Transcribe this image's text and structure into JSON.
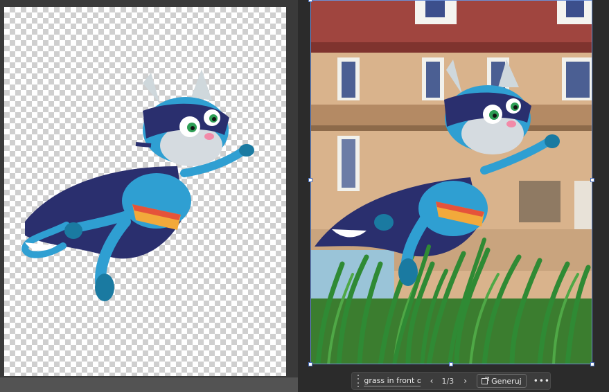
{
  "toolbar": {
    "prompt": "grass in front o...",
    "prev_icon": "chevron-left",
    "next_icon": "chevron-right",
    "counter": "1/3",
    "generate_label": "Generuj",
    "generate_icon": "external-generate",
    "more_icon": "ellipsis"
  },
  "colors": {
    "workspace_bg": "#2b2b2b",
    "left_panel_bg": "#3a3a3a",
    "selection_blue": "#6b8fd6",
    "cat_blue": "#2f9fd2",
    "cape_navy": "#2a2f6e"
  }
}
